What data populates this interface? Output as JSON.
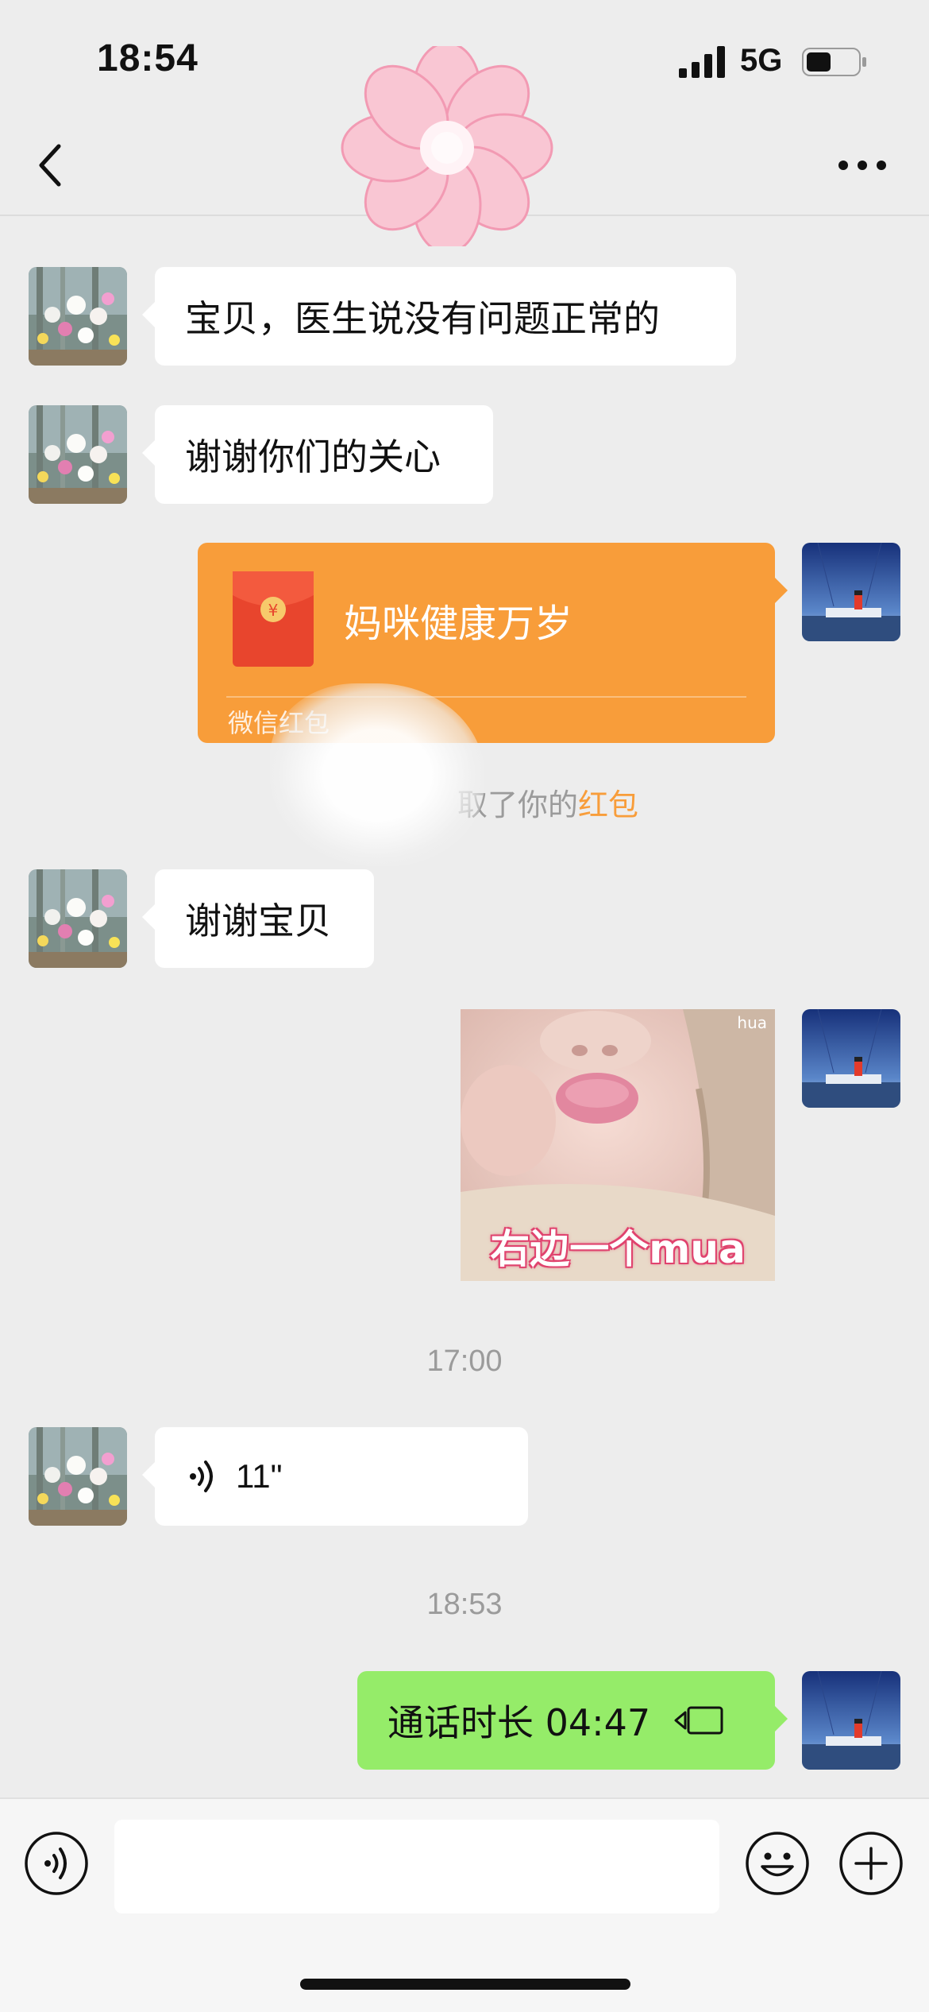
{
  "status_bar": {
    "time": "18:54",
    "network": "5G",
    "battery_icon": "battery-half-icon",
    "signal_icon": "signal-bars-icon"
  },
  "header": {
    "back_icon": "chevron-left-icon",
    "more_icon": "ellipsis-icon",
    "decoration": "pink-flower-sticker"
  },
  "messages": [
    {
      "side": "left",
      "type": "text",
      "text": "宝贝，医生说没有问题正常的"
    },
    {
      "side": "left",
      "type": "text",
      "text": "谢谢你们的关心"
    },
    {
      "side": "right",
      "type": "red_packet",
      "title": "妈咪健康万岁",
      "footer": "微信红包",
      "icon_symbol": "¥"
    },
    {
      "side": "system",
      "type": "notice",
      "text": "取了你的",
      "highlight": "红包"
    },
    {
      "side": "left",
      "type": "text",
      "text": "谢谢宝贝"
    },
    {
      "side": "right",
      "type": "sticker",
      "caption": "右边一个mua",
      "watermark": "hua"
    },
    {
      "side": "system",
      "type": "timestamp",
      "text": "17:00"
    },
    {
      "side": "left",
      "type": "voice",
      "duration": "11\""
    },
    {
      "side": "system",
      "type": "timestamp",
      "text": "18:53"
    },
    {
      "side": "right",
      "type": "call",
      "text": "通话时长 04:47"
    }
  ],
  "input_bar": {
    "voice_icon": "voice-mode-icon",
    "emoji_icon": "emoji-smile-icon",
    "plus_icon": "plus-circle-icon",
    "input_value": ""
  },
  "colors": {
    "background": "#ededed",
    "green_bubble": "#95ec69",
    "red_packet": "#f89d3a",
    "highlight": "#f89d3a"
  }
}
